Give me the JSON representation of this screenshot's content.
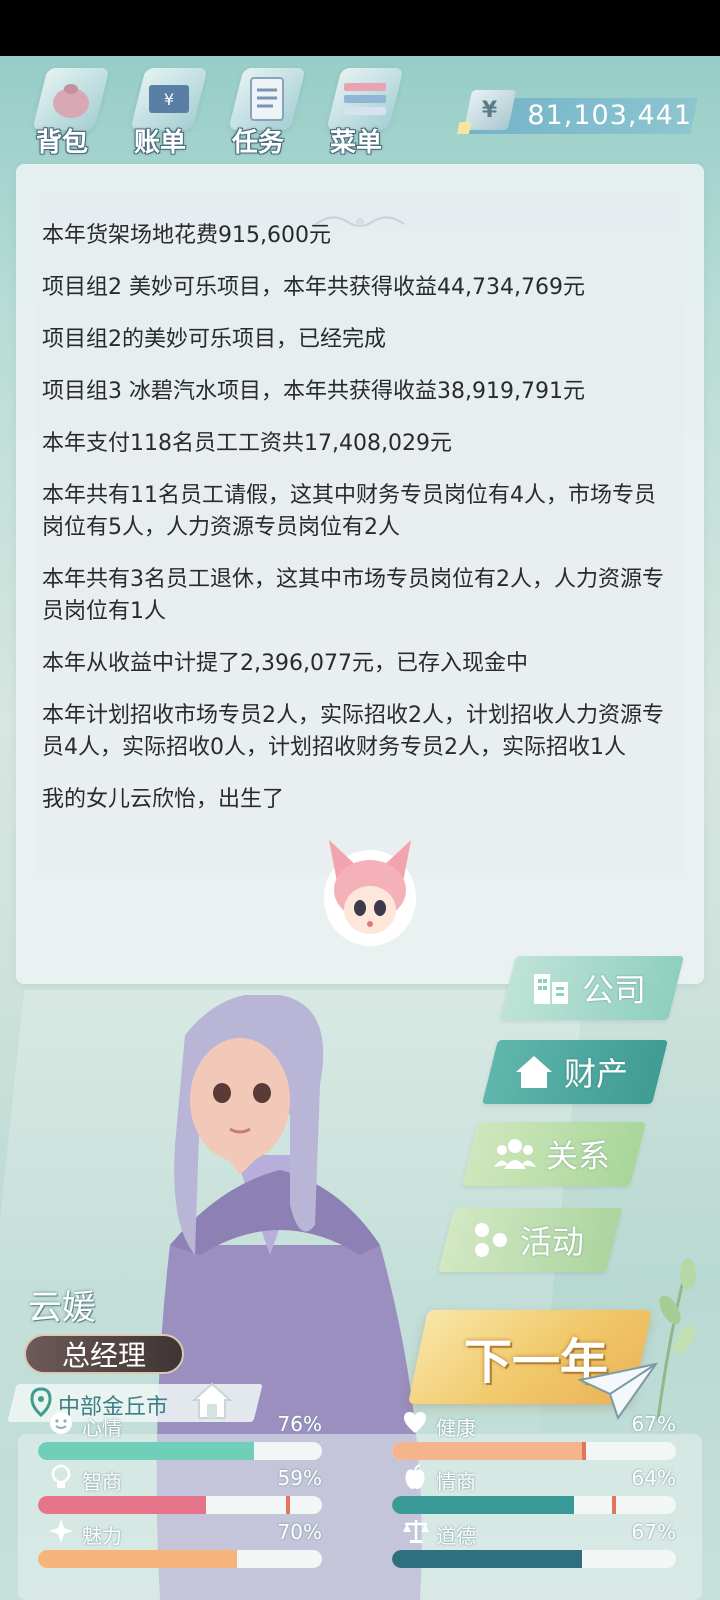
{
  "toolbar": {
    "items": [
      {
        "label": "背包",
        "icon": "bag-icon"
      },
      {
        "label": "账单",
        "icon": "bill-icon"
      },
      {
        "label": "任务",
        "icon": "task-icon"
      },
      {
        "label": "菜单",
        "icon": "menu-icon"
      }
    ]
  },
  "money": {
    "currency_symbol": "¥",
    "amount": "81,103,441"
  },
  "log": {
    "lines": [
      "本年货架场地花费915,600元",
      "项目组2 美妙可乐项目，本年共获得收益44,734,769元",
      "项目组2的美妙可乐项目，已经完成",
      "项目组3 冰碧汽水项目，本年共获得收益38,919,791元",
      "本年支付118名员工工资共17,408,029元",
      "本年共有11名员工请假，这其中财务专员岗位有4人，市场专员岗位有5人，人力资源专员岗位有2人",
      "本年共有3名员工退休，这其中市场专员岗位有2人，人力资源专员岗位有1人",
      "本年从收益中计提了2,396,077元，已存入现金中",
      "本年计划招收市场专员2人，实际招收2人，计划招收人力资源专员4人，实际招收0人，计划招收财务专员2人，实际招收1人",
      "我的女儿云欣怡，出生了"
    ]
  },
  "side_buttons": {
    "company": "公司",
    "property": "财产",
    "relations": "关系",
    "activities": "活动"
  },
  "next_year": "下一年",
  "character": {
    "name": "云媛",
    "title": "总经理",
    "location": "中部金丘市"
  },
  "stats": {
    "mood": {
      "label": "心情",
      "value": "76%",
      "level": 0.76,
      "color": "#6fcfb8"
    },
    "health": {
      "label": "健康",
      "value": "67%",
      "level": 0.67,
      "color": "#f5b58c"
    },
    "iq": {
      "label": "智商",
      "value": "59%",
      "level": 0.59,
      "color": "#e6758a"
    },
    "eq": {
      "label": "情商",
      "value": "64%",
      "level": 0.64,
      "color": "#3a9a98"
    },
    "charm": {
      "label": "魅力",
      "value": "70%",
      "level": 0.7,
      "color": "#f5b47a"
    },
    "morality": {
      "label": "道德",
      "value": "67%",
      "level": 0.67,
      "color": "#2f6f7e"
    }
  }
}
